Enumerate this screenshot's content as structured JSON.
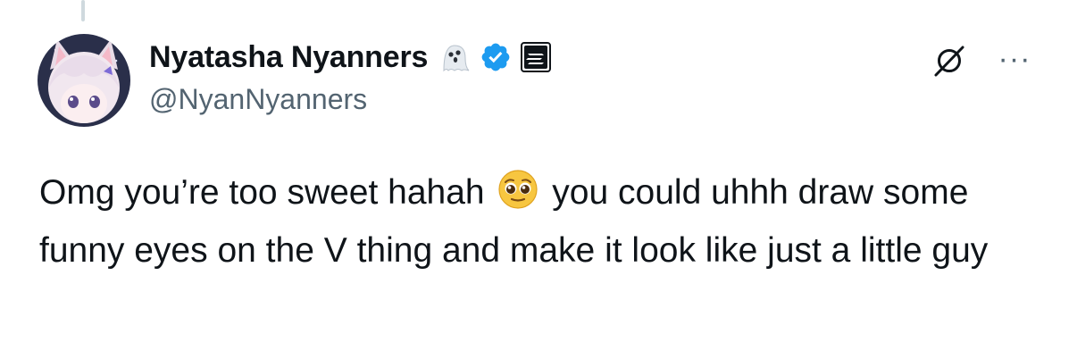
{
  "author": {
    "display_name": "Nyatasha Nyanners",
    "handle": "@NyanNyanners",
    "badges": [
      "ghost-emoji",
      "verified-checkmark",
      "affiliate-label"
    ],
    "verified_color": "#1d9bf0"
  },
  "actions": {
    "grok_icon": "slashed-circle-icon",
    "more_label": "···"
  },
  "tweet": {
    "line1_part1": "Omg you’re too sweet hahah ",
    "emoji": "pleading-face-emoji",
    "line1_part2": " you could uhhh draw some funny eyes on the V thing and make it look like just a little guy"
  }
}
